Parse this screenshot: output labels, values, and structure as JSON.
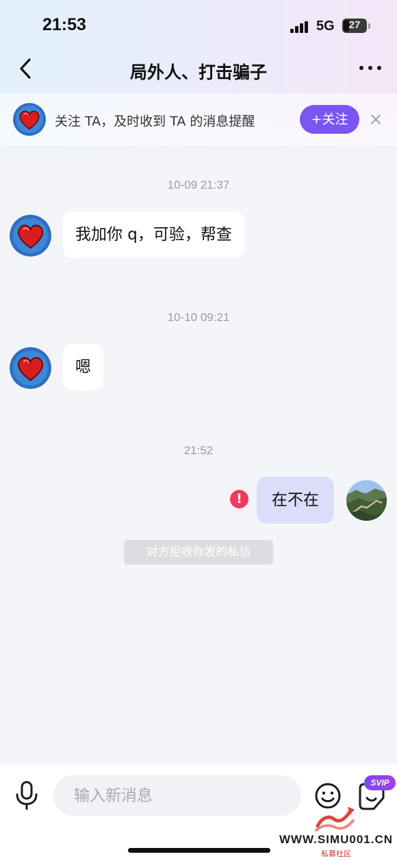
{
  "status_bar": {
    "time": "21:53",
    "network": "5G",
    "battery": "27"
  },
  "nav": {
    "title": "局外人、打击骗子"
  },
  "follow_banner": {
    "text": "关注 TA，及时收到 TA 的消息提醒",
    "button_label": "+关注"
  },
  "messages": [
    {
      "type": "timestamp",
      "text": "10-09  21:37"
    },
    {
      "type": "incoming",
      "text": "我加你 q，可验，帮查"
    },
    {
      "type": "timestamp",
      "text": "10-10  09:21"
    },
    {
      "type": "incoming",
      "text": "嗯"
    },
    {
      "type": "timestamp",
      "text": "21:52"
    },
    {
      "type": "outgoing",
      "text": "在不在",
      "failed": true
    },
    {
      "type": "system",
      "text": "对方拒收你发的私信"
    }
  ],
  "composer": {
    "placeholder": "输入新消息",
    "badge": "SVIP"
  },
  "watermark": {
    "url": "WWW.SIMU001.CN",
    "sub": "私募社区"
  },
  "colors": {
    "accent": "#7b55f2",
    "outgoing_bubble": "#dcdcfb",
    "error": "#ef3a5d"
  },
  "icons": {
    "back": "chevron-left-icon",
    "more": "more-dots-icon",
    "close": "close-icon",
    "mic": "microphone-icon",
    "emoji": "emoji-icon",
    "sticker": "sticker-icon",
    "error": "exclamation-icon"
  }
}
